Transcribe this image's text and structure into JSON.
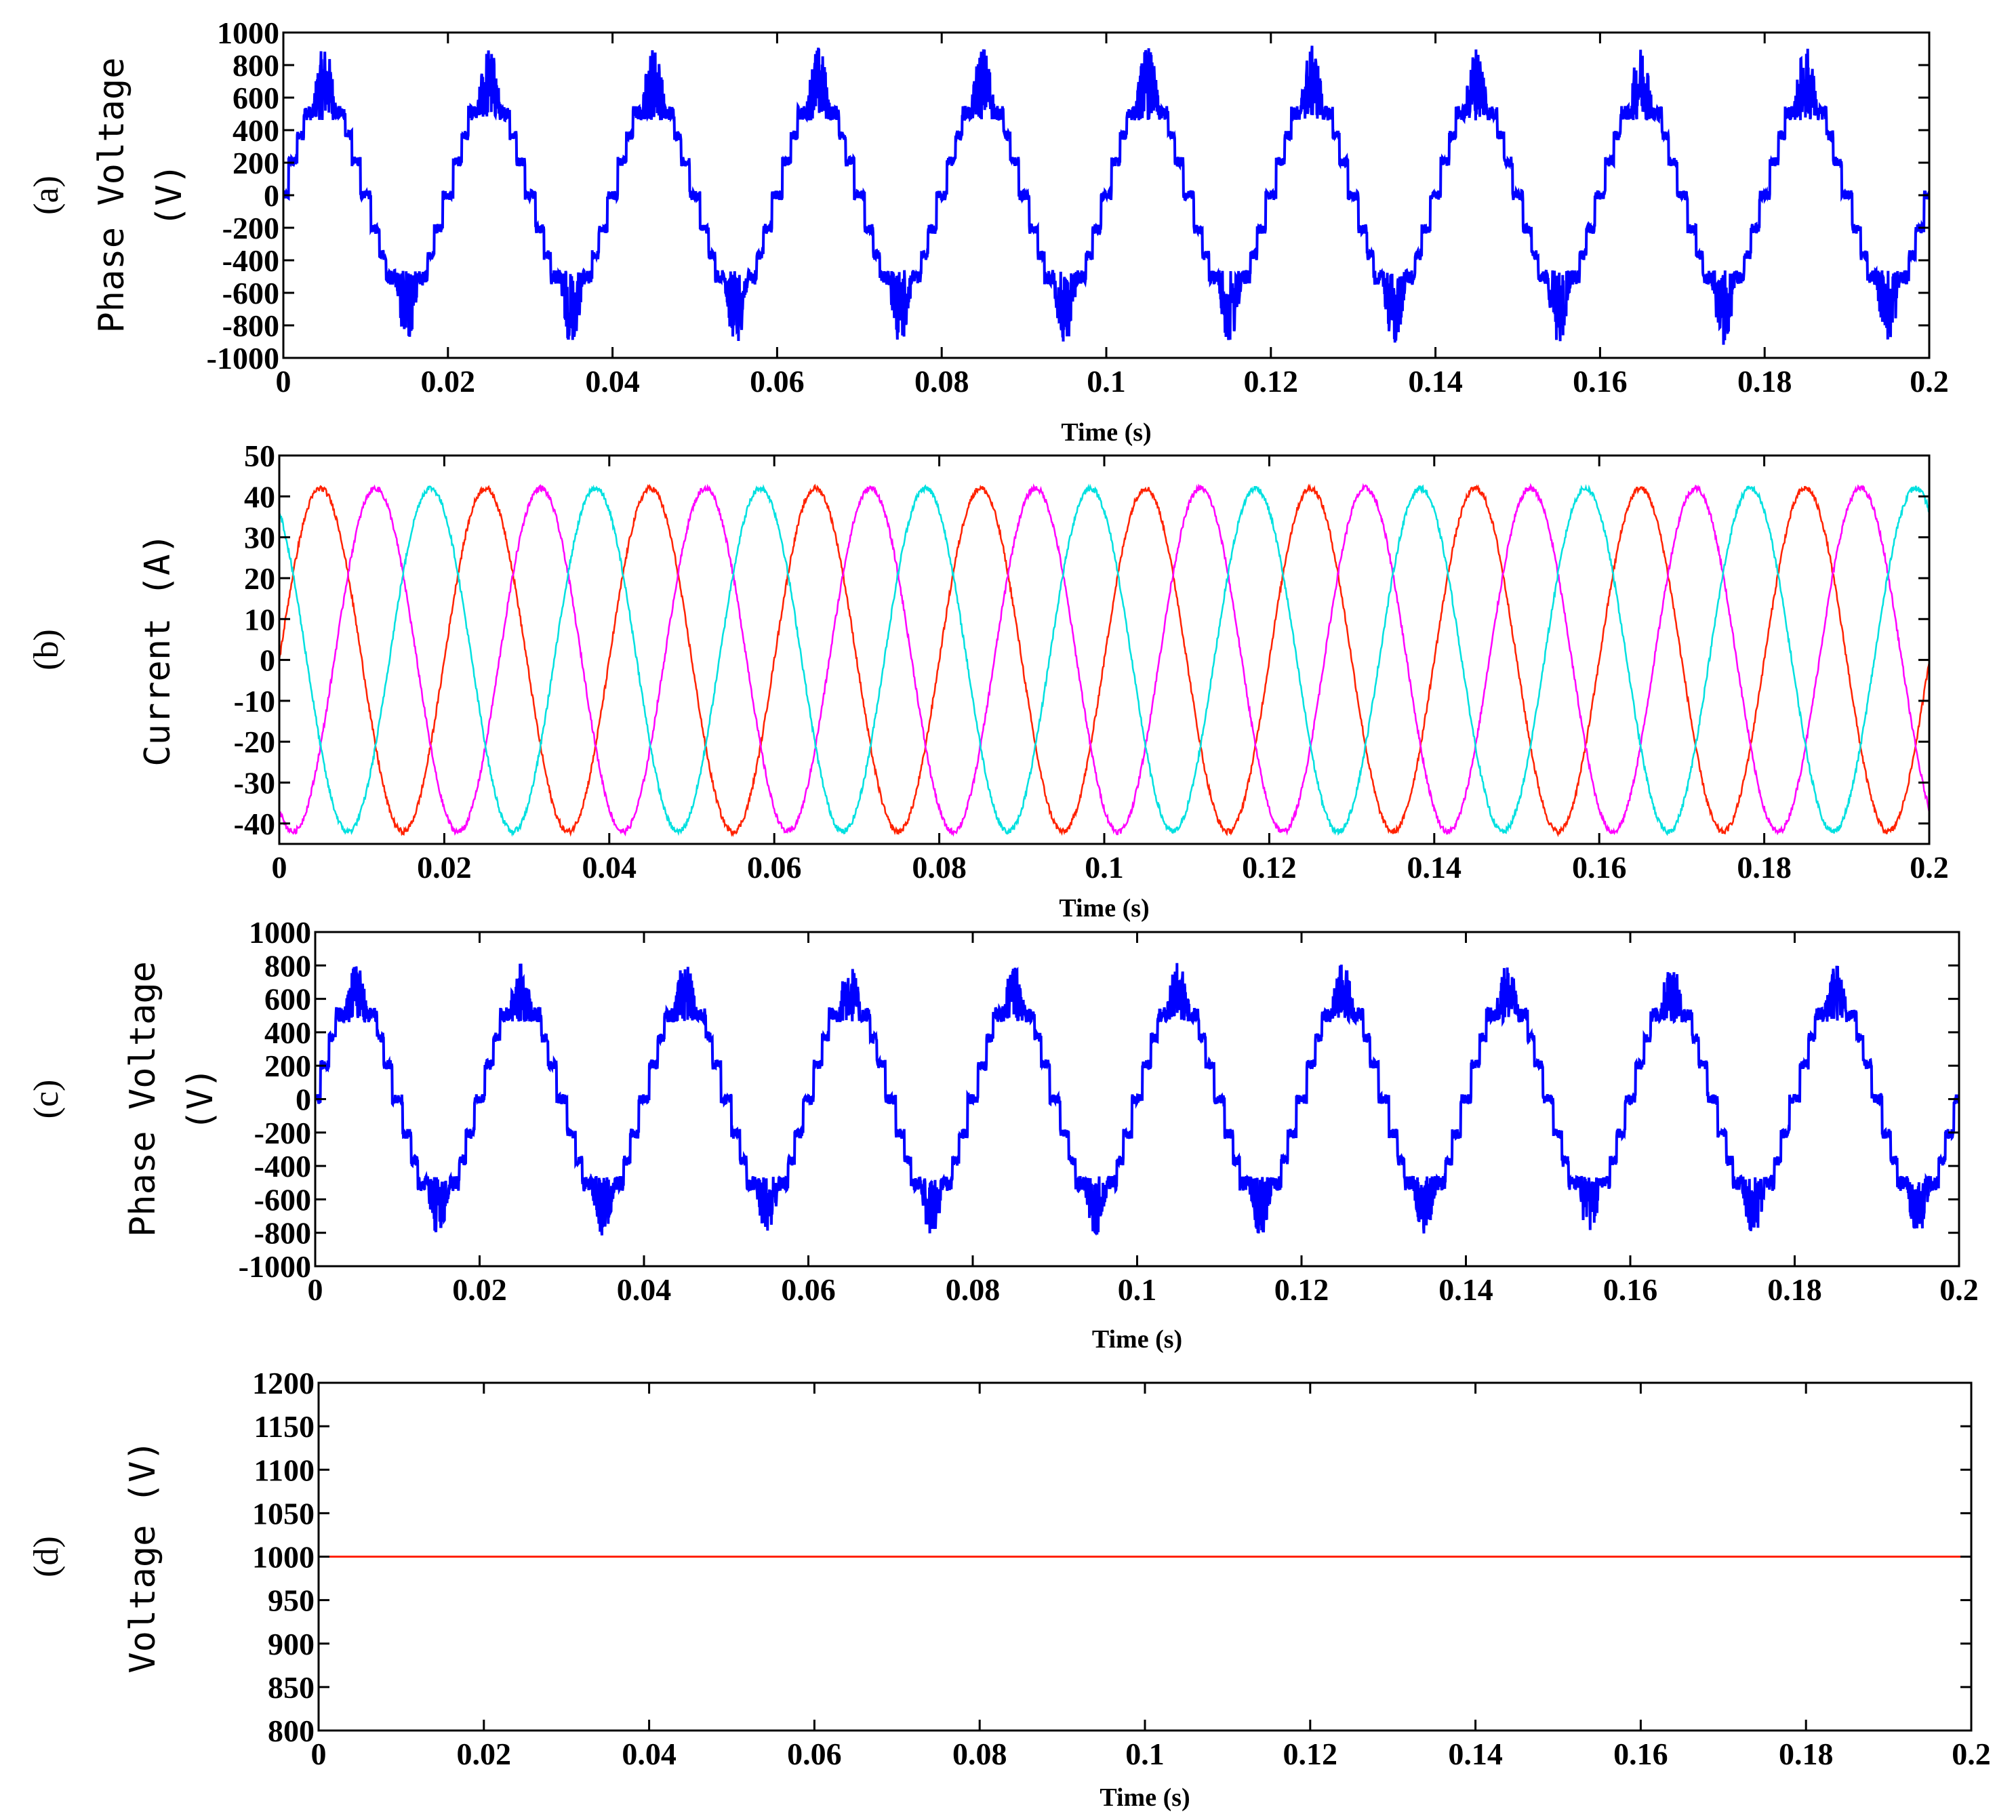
{
  "chart_data": [
    {
      "panel": "(a)",
      "type": "line",
      "xlabel": "Time (s)",
      "ylabel": "Phase Voltage (V)",
      "xlim": [
        0,
        0.2
      ],
      "ylim": [
        -1000,
        1000
      ],
      "xticks": [
        "0",
        "0.02",
        "0.04",
        "0.06",
        "0.08",
        "0.1",
        "0.12",
        "0.14",
        "0.16",
        "0.18",
        "0.2"
      ],
      "yticks": [
        "1000",
        "800",
        "600",
        "400",
        "200",
        "0",
        "-200",
        "-400",
        "-600",
        "-800",
        "-1000"
      ],
      "series": [
        {
          "color": "#0000ff",
          "frequency_hz": 50,
          "peak": 920,
          "step_levels": [
            0,
            460
          ]
        }
      ]
    },
    {
      "panel": "(b)",
      "type": "line",
      "xlabel": "Time (s)",
      "ylabel": "Current (A)",
      "xlim": [
        0,
        0.2
      ],
      "ylim": [
        -45,
        50
      ],
      "xticks": [
        "0",
        "0.02",
        "0.04",
        "0.06",
        "0.08",
        "0.1",
        "0.12",
        "0.14",
        "0.16",
        "0.18",
        "0.2"
      ],
      "yticks": [
        "50",
        "40",
        "30",
        "20",
        "10",
        "0",
        "-10",
        "-20",
        "-30",
        "-40"
      ],
      "series": [
        {
          "color": "#ff2200",
          "frequency_hz": 50,
          "amplitude": 42,
          "phase_deg": 0
        },
        {
          "color": "#ff00ff",
          "frequency_hz": 50,
          "amplitude": 42,
          "phase_deg": -120
        },
        {
          "color": "#00e0e0",
          "frequency_hz": 50,
          "amplitude": 42,
          "phase_deg": 120
        }
      ]
    },
    {
      "panel": "(c)",
      "type": "line",
      "xlabel": "Time (s)",
      "ylabel": "Phase Voltage (V)",
      "xlim": [
        0,
        0.2
      ],
      "ylim": [
        -1000,
        1000
      ],
      "xticks": [
        "0",
        "0.02",
        "0.04",
        "0.06",
        "0.08",
        "0.1",
        "0.12",
        "0.14",
        "0.16",
        "0.18",
        "0.2"
      ],
      "yticks": [
        "1000",
        "800",
        "600",
        "400",
        "200",
        "0",
        "-200",
        "-400",
        "-600",
        "-800",
        "-1000"
      ],
      "series": [
        {
          "color": "#0000ff",
          "frequency_hz": 50,
          "peak": 820,
          "step_levels": [
            0,
            460
          ]
        }
      ]
    },
    {
      "panel": "(d)",
      "type": "line",
      "xlabel": "Time (s)",
      "ylabel": "Voltage (V)",
      "xlim": [
        0,
        0.2
      ],
      "ylim": [
        800,
        1200
      ],
      "xticks": [
        "0",
        "0.02",
        "0.04",
        "0.06",
        "0.08",
        "0.1",
        "0.12",
        "0.14",
        "0.16",
        "0.18",
        "0.2"
      ],
      "yticks": [
        "1200",
        "1150",
        "1100",
        "1050",
        "1000",
        "950",
        "900",
        "850",
        "800"
      ],
      "series": [
        {
          "color": "#ff2200",
          "x": [
            0,
            0.2
          ],
          "y": [
            1000,
            1000
          ]
        }
      ]
    }
  ]
}
